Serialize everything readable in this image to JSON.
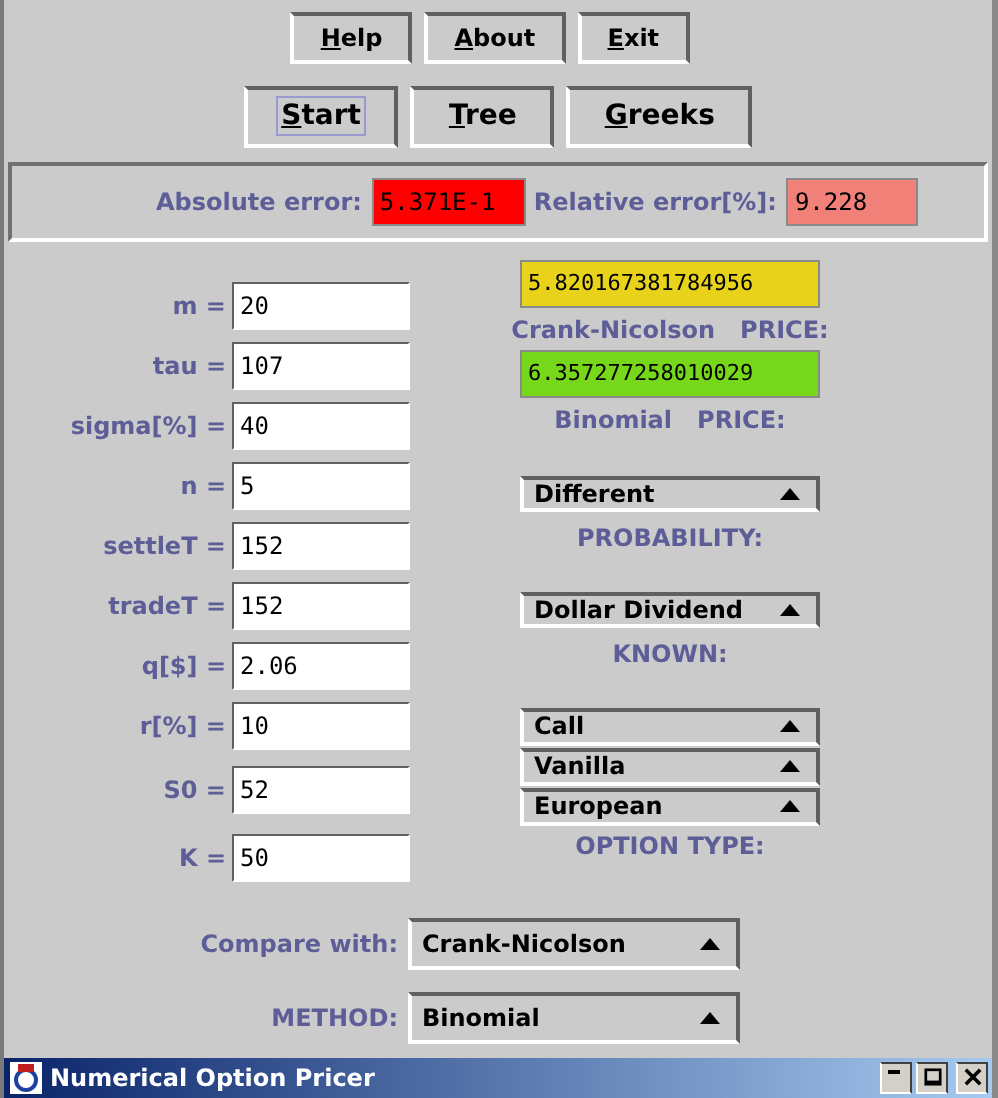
{
  "menu_buttons": [
    "Help",
    "About",
    "Exit"
  ],
  "actions": [
    {
      "label": "Start",
      "focused": true
    },
    {
      "label": "Tree",
      "focused": false
    },
    {
      "label": "Greeks",
      "focused": false
    }
  ],
  "errors": [
    {
      "label": "Absolute error:",
      "value": "5.371E-1",
      "color": "#ff0000"
    },
    {
      "label": "Relative error[%]:",
      "value": "9.228",
      "color": "#f08078"
    }
  ],
  "prices": [
    {
      "label": "Crank-Nicolson   PRICE:",
      "value": "5.820167381784956",
      "color": "#e8d31a"
    },
    {
      "label": "Binomial   PRICE:",
      "value": "6.357277258010029",
      "color": "#77d71b"
    }
  ],
  "probability": {
    "label": "PROBABILITY:",
    "value": "Different"
  },
  "known": {
    "label": "KNOWN:",
    "value": "Dollar Dividend"
  },
  "option_type": {
    "selects": [
      "Call",
      "Vanilla",
      "European"
    ],
    "label": "OPTION TYPE:"
  },
  "inputs": [
    {
      "label": "m =",
      "value": "20"
    },
    {
      "label": "tau =",
      "value": "107"
    },
    {
      "label": "sigma[%] =",
      "value": "40"
    },
    {
      "label": "n =",
      "value": "5"
    },
    {
      "label": "settleT =",
      "value": "152"
    },
    {
      "label": "tradeT =",
      "value": "152"
    },
    {
      "label": "q[$] =",
      "value": "2.06"
    },
    {
      "label": "r[%] =",
      "value": "10"
    },
    {
      "label": "S0 =",
      "value": "52"
    },
    {
      "label": "K =",
      "value": "50"
    }
  ],
  "compare": {
    "label": "Compare with:",
    "value": "Crank-Nicolson"
  },
  "method": {
    "label": "METHOD:",
    "value": "Binomial"
  },
  "window": {
    "title": "Numerical Option Pricer"
  }
}
